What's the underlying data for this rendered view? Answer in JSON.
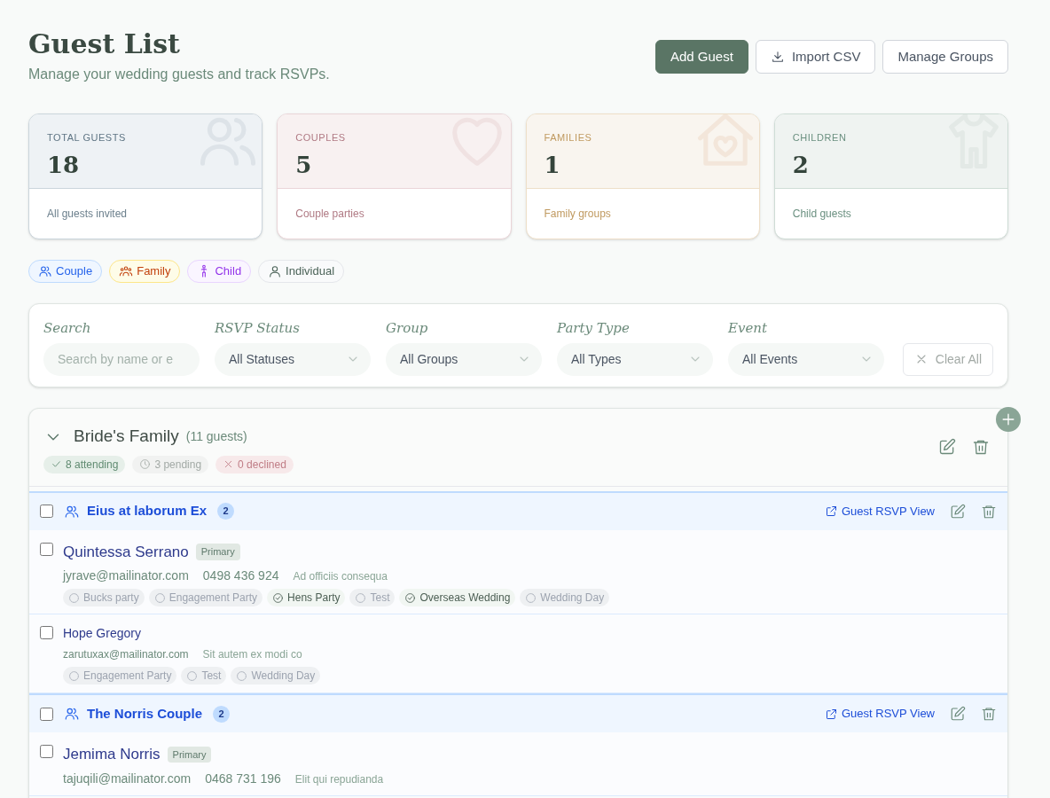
{
  "header": {
    "title": "Guest List",
    "subtitle": "Manage your wedding guests and track RSVPs.",
    "buttons": [
      {
        "label": "Add Guest",
        "kind": "primary"
      },
      {
        "label": "Import CSV",
        "kind": "import"
      },
      {
        "label": "Manage Groups",
        "kind": "plain"
      }
    ]
  },
  "stats": [
    {
      "label": "TOTAL GUESTS",
      "value": "18",
      "caption": "All guests invited",
      "kind": "total"
    },
    {
      "label": "COUPLES",
      "value": "5",
      "caption": "Couple parties",
      "kind": "couples"
    },
    {
      "label": "FAMILIES",
      "value": "1",
      "caption": "Family groups",
      "kind": "families"
    },
    {
      "label": "CHILDREN",
      "value": "2",
      "caption": "Child guests",
      "kind": "children"
    }
  ],
  "legend": [
    {
      "label": "Couple",
      "kind": "couple"
    },
    {
      "label": "Family",
      "kind": "family"
    },
    {
      "label": "Child",
      "kind": "child"
    },
    {
      "label": "Individual",
      "kind": "individual"
    }
  ],
  "filters": {
    "search": {
      "label": "Search",
      "placeholder": "Search by name or e"
    },
    "selects": [
      {
        "label": "RSVP Status",
        "value": "All Statuses"
      },
      {
        "label": "Group",
        "value": "All Groups"
      },
      {
        "label": "Party Type",
        "value": "All Types"
      },
      {
        "label": "Event",
        "value": "All Events"
      }
    ],
    "clear_button": "Clear All"
  },
  "group": {
    "title": "Bride's Family",
    "count": "(11 guests)",
    "expanded": true,
    "stats": [
      {
        "kind": "attending",
        "text": "8 attending"
      },
      {
        "kind": "pending",
        "text": "3 pending"
      },
      {
        "kind": "declined",
        "text": "0 declined"
      }
    ],
    "parties": [
      {
        "name": "Eius at laborum Ex",
        "count": "2",
        "kind": "couple",
        "checked": false,
        "link": "Guest RSVP View",
        "guests": [
          {
            "name": "Quintessa Serrano",
            "badge": "Primary",
            "checked": false,
            "email": "jyrave@mailinator.com",
            "phone": "0498 436 924",
            "note": "Ad officiis consequa",
            "events": [
              {
                "name": "Bucks party",
                "attending": false
              },
              {
                "name": "Engagement Party",
                "attending": false
              },
              {
                "name": "Hens Party",
                "attending": true
              },
              {
                "name": "Test",
                "attending": false
              },
              {
                "name": "Overseas Wedding",
                "attending": true
              },
              {
                "name": "Wedding Day",
                "attending": false
              }
            ]
          },
          {
            "name": "Hope Gregory",
            "checked": false,
            "email": "zarutuxax@mailinator.com",
            "note": "Sit autem ex modi co",
            "events": [
              {
                "name": "Engagement Party",
                "attending": false
              },
              {
                "name": "Test",
                "attending": false
              },
              {
                "name": "Wedding Day",
                "attending": false
              }
            ]
          }
        ]
      },
      {
        "name": "The Norris Couple",
        "count": "2",
        "kind": "couple",
        "checked": false,
        "link": "Guest RSVP View",
        "guests": [
          {
            "name": "Jemima Norris",
            "badge": "Primary",
            "checked": false,
            "email": "tajuqili@mailinator.com",
            "phone": "0468 731 196",
            "note": "Elit qui repudianda"
          }
        ]
      }
    ]
  }
}
